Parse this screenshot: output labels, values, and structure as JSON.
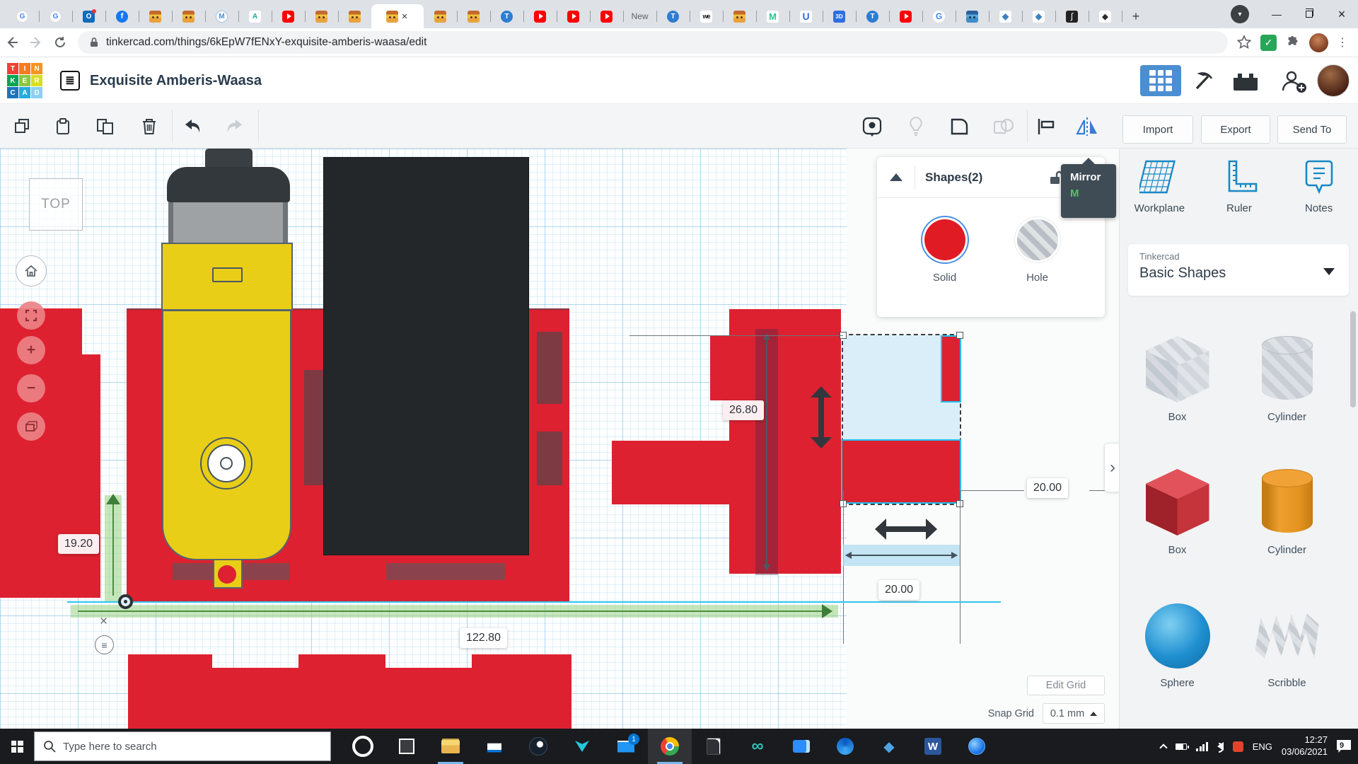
{
  "colors": {
    "selection_cyan": "#22c0ef",
    "solid_red": "#dd2130",
    "mirror_shortcut_green": "#57c168",
    "brand_blue": "#1789c6",
    "header_grid_button_blue": "#4b8fd2"
  },
  "browser": {
    "url": "tinkercad.com/things/6kEpW7fENxY-exquisite-amberis-waasa/edit",
    "tabs": [
      {
        "type": "translate"
      },
      {
        "type": "translate"
      },
      {
        "type": "outlook"
      },
      {
        "type": "facebook"
      },
      {
        "type": "robot"
      },
      {
        "type": "robot"
      },
      {
        "type": "mhex",
        "glyph": "M"
      },
      {
        "type": "autodesk",
        "glyph": "A"
      },
      {
        "type": "youtube"
      },
      {
        "type": "robot"
      },
      {
        "type": "robot"
      },
      {
        "type": "robot",
        "active": true
      },
      {
        "type": "robot"
      },
      {
        "type": "robot"
      },
      {
        "type": "tinkercad",
        "glyph": "T"
      },
      {
        "type": "youtube"
      },
      {
        "type": "youtube"
      },
      {
        "type": "youtube"
      },
      {
        "type": "newtext",
        "label": "New"
      },
      {
        "type": "tinkercad",
        "glyph": "T"
      },
      {
        "type": "we",
        "glyph": "we"
      },
      {
        "type": "robot"
      },
      {
        "type": "mgreen",
        "glyph": "M"
      },
      {
        "type": "ublue",
        "glyph": "U"
      },
      {
        "type": "threed",
        "glyph": "3D"
      },
      {
        "type": "tinkercad",
        "glyph": "T"
      },
      {
        "type": "youtube"
      },
      {
        "type": "google",
        "glyph": "G"
      },
      {
        "type": "robotblue"
      },
      {
        "type": "cura"
      },
      {
        "type": "cura"
      },
      {
        "type": "integral",
        "glyph": "∫"
      },
      {
        "type": "inkscape"
      }
    ]
  },
  "header": {
    "title": "Exquisite Amberis-Waasa",
    "logo_letters": [
      "T",
      "I",
      "N",
      "K",
      "E",
      "R",
      "C",
      "A",
      "D"
    ]
  },
  "toolbar": {
    "import": "Import",
    "export": "Export",
    "send_to": "Send To"
  },
  "shapes_panel": {
    "title": "Shapes(2)",
    "solid": "Solid",
    "hole": "Hole"
  },
  "mirror_tooltip": {
    "label": "Mirror",
    "shortcut": "M"
  },
  "sidebar": {
    "tools": [
      {
        "label": "Workplane"
      },
      {
        "label": "Ruler"
      },
      {
        "label": "Notes"
      }
    ],
    "library_kicker": "Tinkercad",
    "library_name": "Basic Shapes",
    "shapes": [
      {
        "label": "Box",
        "variant": "hole-box"
      },
      {
        "label": "Cylinder",
        "variant": "hole-cylinder"
      },
      {
        "label": "Box",
        "variant": "red-box"
      },
      {
        "label": "Cylinder",
        "variant": "orange-cylinder"
      },
      {
        "label": "Sphere",
        "variant": "sphere"
      },
      {
        "label": "Scribble",
        "variant": "scribble"
      }
    ]
  },
  "canvas": {
    "view_cube": "TOP",
    "dim_height": "19.20",
    "dim_column": "26.80",
    "dim_length": "122.80",
    "dim_right": "20.00",
    "dim_bottom": "20.00",
    "edit_grid": "Edit Grid",
    "snap_grid_label": "Snap Grid",
    "snap_grid_value": "0.1 mm"
  },
  "taskbar": {
    "search_placeholder": "Type here to search",
    "icons": [
      {
        "type": "opera"
      },
      {
        "type": "taskview"
      },
      {
        "type": "explorer",
        "open": true
      },
      {
        "type": "store"
      },
      {
        "type": "steam"
      },
      {
        "type": "predator"
      },
      {
        "type": "mail",
        "badge": "1"
      },
      {
        "type": "chrome",
        "active": true
      },
      {
        "type": "epic"
      },
      {
        "type": "infinity",
        "glyph": "∞"
      },
      {
        "type": "video"
      },
      {
        "type": "swirl"
      },
      {
        "type": "diamond",
        "glyph": "◆"
      },
      {
        "type": "word"
      },
      {
        "type": "globe"
      }
    ],
    "language": "ENG",
    "time": "12:27",
    "date": "03/06/2021",
    "notifications": "9"
  }
}
